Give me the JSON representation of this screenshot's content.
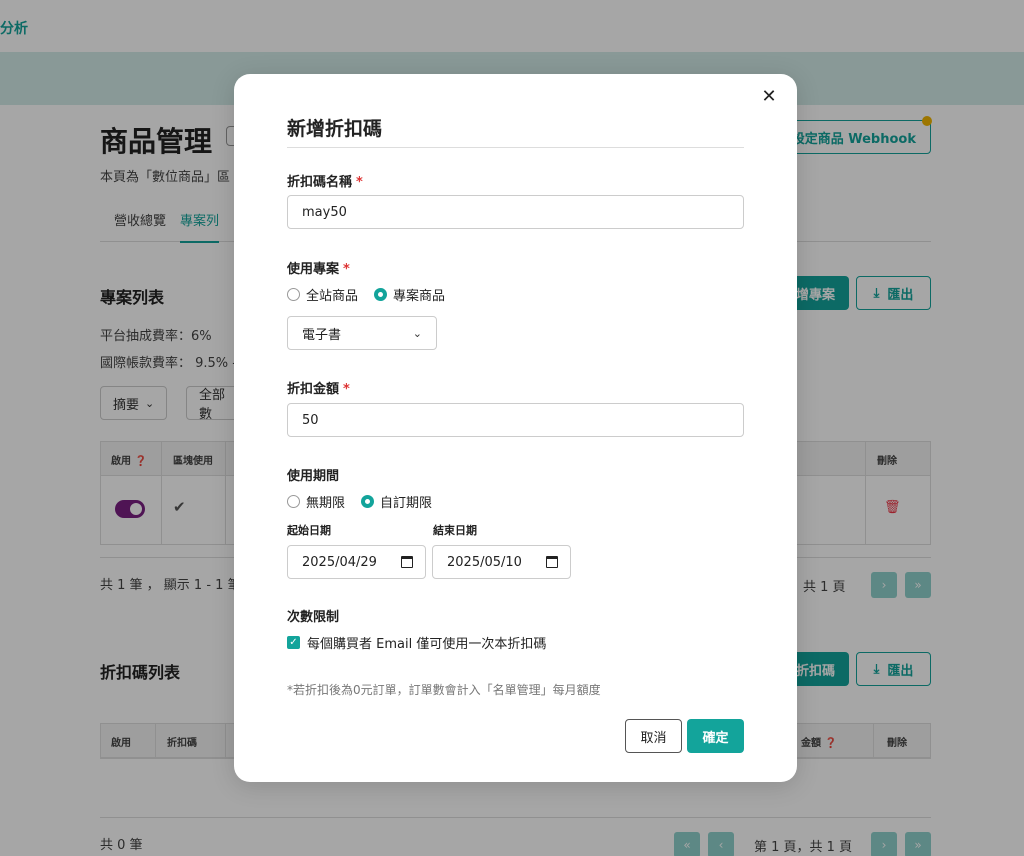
{
  "nav": {
    "brand": "分析"
  },
  "page": {
    "title": "商品管理",
    "description": "本頁為「數位商品」區",
    "webhook_label": "設定商品 Webhook",
    "tabs": [
      "營收總覽",
      "專案列"
    ]
  },
  "projects": {
    "title": "專案列表",
    "add_label": "增專案",
    "export_label": "匯出",
    "platform_fee": "平台抽成費率：6%",
    "intl_fee": "國際帳款費率： 9.5% -",
    "filter_summary": "摘要",
    "filter_all": "全部數",
    "columns": {
      "enable": "啟用",
      "region": "區塊使用",
      "delete": "刪除"
    },
    "count_text": "共 1 筆 ， 顯示 1 - 1 筆",
    "pager_text": "，共 1 頁"
  },
  "discounts": {
    "title": "折扣碼列表",
    "add_label": "折扣碼",
    "export_label": "匯出",
    "columns": {
      "enable": "啟用",
      "code": "折扣碼",
      "amount": "金額",
      "delete": "刪除"
    },
    "count_text": "共 0 筆",
    "pager_text": "第 1 頁，共 1 頁"
  },
  "modal": {
    "title": "新增折扣碼",
    "name_label": "折扣碼名稱",
    "name_value": "may50",
    "scope_label": "使用專案",
    "scope_options": [
      "全站商品",
      "專案商品"
    ],
    "scope_selected": "專案商品",
    "project_select": "電子書",
    "amount_label": "折扣金額",
    "amount_value": "50",
    "period_label": "使用期間",
    "period_options": [
      "無期限",
      "自訂期限"
    ],
    "period_selected": "自訂期限",
    "start_label": "起始日期",
    "start_value": "2025/04/29",
    "end_label": "結束日期",
    "end_value": "2025/05/10",
    "limit_label": "次數限制",
    "limit_checkbox": "每個購買者 Email 僅可使用一次本折扣碼",
    "limit_checked": true,
    "note": "*若折扣後為0元訂單，訂單數會計入「名單管理」每月額度",
    "cancel_label": "取消",
    "confirm_label": "確定",
    "required_mark": "*"
  },
  "colors": {
    "accent": "#13a49b",
    "toggle": "#7a1f82",
    "danger": "#dd3333"
  }
}
